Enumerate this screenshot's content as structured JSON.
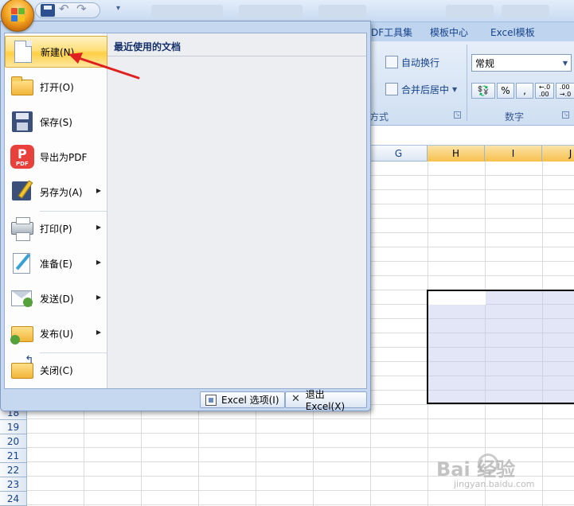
{
  "ribbon": {
    "tabs": [
      "DF工具集",
      "模板中心",
      "Excel模板"
    ],
    "wrap_text": "自动换行",
    "merge_center": "合并后居中",
    "format_group": "方式",
    "number_format": "常规",
    "percent": "%",
    "comma": ",",
    "increase_decimal": "←.0 .00",
    "decrease_decimal": ".00 →.0",
    "number_group": "数字"
  },
  "sheet": {
    "columns": [
      {
        "label": "G",
        "selected": false
      },
      {
        "label": "H",
        "selected": true
      },
      {
        "label": "I",
        "selected": true
      },
      {
        "label": "J",
        "selected": true
      }
    ],
    "rows": [
      "18",
      "19",
      "20",
      "21",
      "22",
      "23",
      "24"
    ]
  },
  "office_menu": {
    "items": [
      {
        "label": "新建(N)",
        "icon": "new-document-icon",
        "submenu": false,
        "highlighted": true
      },
      {
        "label": "打开(O)",
        "icon": "open-folder-icon",
        "submenu": false
      },
      {
        "label": "保存(S)",
        "icon": "save-floppy-icon",
        "submenu": false
      },
      {
        "label": "导出为PDF",
        "icon": "pdf-icon",
        "submenu": false
      },
      {
        "label": "另存为(A)",
        "icon": "save-as-icon",
        "submenu": true
      },
      {
        "label": "打印(P)",
        "icon": "printer-icon",
        "submenu": true
      },
      {
        "label": "准备(E)",
        "icon": "prepare-icon",
        "submenu": true
      },
      {
        "label": "发送(D)",
        "icon": "send-icon",
        "submenu": true
      },
      {
        "label": "发布(U)",
        "icon": "publish-icon",
        "submenu": true
      },
      {
        "label": "关闭(C)",
        "icon": "close-folder-icon",
        "submenu": false
      }
    ],
    "recent_header": "最近使用的文档",
    "options_button": "Excel 选项(I)",
    "exit_button": "退出 Excel(X)"
  },
  "watermark": {
    "text": "Bai 经验",
    "url": "jingyan.baidu.com"
  },
  "colors": {
    "highlight": "#ffdf7a",
    "ribbon_bg": "#cfdff2",
    "arrow": "#e02020",
    "office_button": "#f5a623"
  }
}
